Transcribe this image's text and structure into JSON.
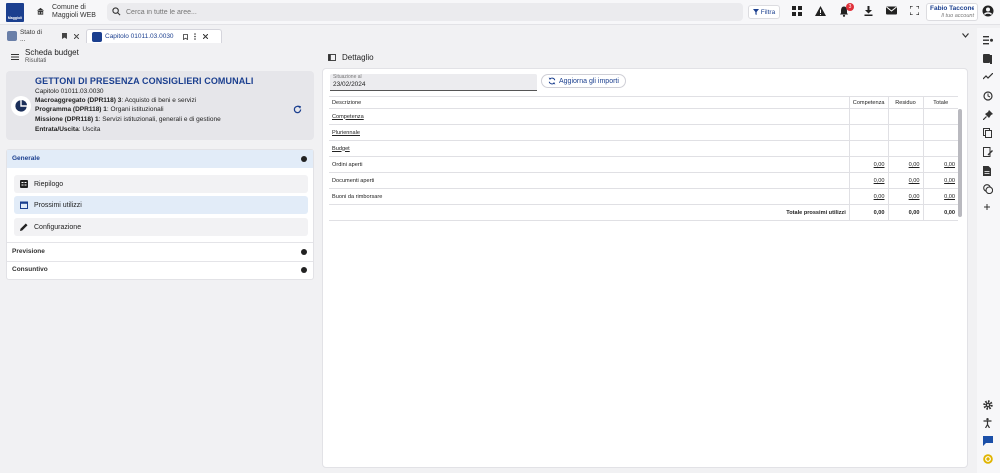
{
  "app": {
    "logo_text": "Maggioli",
    "org_line1": "Comune di",
    "org_line2": "Maggioli WEB",
    "search_placeholder": "Cerca in tutte le aree...",
    "filter_label": "Filtra",
    "notification_count": "3",
    "user_name": "Fabio Tacconelli",
    "user_role": "Il tuo account"
  },
  "tabs": [
    {
      "label": "Stato di ..."
    },
    {
      "label": "Capitolo 01011.03.0030"
    }
  ],
  "left": {
    "title": "Scheda budget",
    "subtitle": "Risultati",
    "capitolo": {
      "heading": "GETTONI DI PRESENZA CONSIGLIERI COMUNALI",
      "code": "Capitolo 01011.03.0030",
      "macro_label": "Macroaggregato (DPR118) 3",
      "macro_value": ": Acquisto di beni e servizi",
      "prog_label": "Programma (DPR118) 1",
      "prog_value": ": Organi istituzionali",
      "miss_label": "Missione (DPR118) 1",
      "miss_value": ": Servizi istituzionali, generali e di gestione",
      "eu_label": "Entrata/Uscita",
      "eu_value": ": Uscita"
    },
    "sections": {
      "generale": "Generale",
      "previsione": "Previsione",
      "consuntivo": "Consuntivo"
    },
    "items": {
      "riepilogo": "Riepilogo",
      "prossimi": "Prossimi utilizzi",
      "configurazione": "Configurazione"
    }
  },
  "detail": {
    "title": "Dettaglio",
    "situazione_label": "Situazione al",
    "situazione_value": "23/02/2024",
    "aggiorna_label": "Aggiorna gli importi",
    "columns": [
      "Descrizione",
      "Competenza",
      "Residuo",
      "Totale"
    ],
    "rows": [
      {
        "desc": "Competenza",
        "comp": "",
        "res": "",
        "tot": ""
      },
      {
        "desc": "Pluriennale",
        "comp": "",
        "res": "",
        "tot": ""
      },
      {
        "desc": "Budget",
        "comp": "",
        "res": "",
        "tot": ""
      },
      {
        "desc": "Ordini aperti",
        "comp": "0,00",
        "res": "0,00",
        "tot": "0,00"
      },
      {
        "desc": "Documenti aperti",
        "comp": "0,00",
        "res": "0,00",
        "tot": "0,00"
      },
      {
        "desc": "Buoni da rimborsare",
        "comp": "0,00",
        "res": "0,00",
        "tot": "0,00"
      }
    ],
    "total": {
      "label": "Totale prossimi utilizzi",
      "comp": "0,00",
      "res": "0,00",
      "tot": "0,00"
    }
  }
}
